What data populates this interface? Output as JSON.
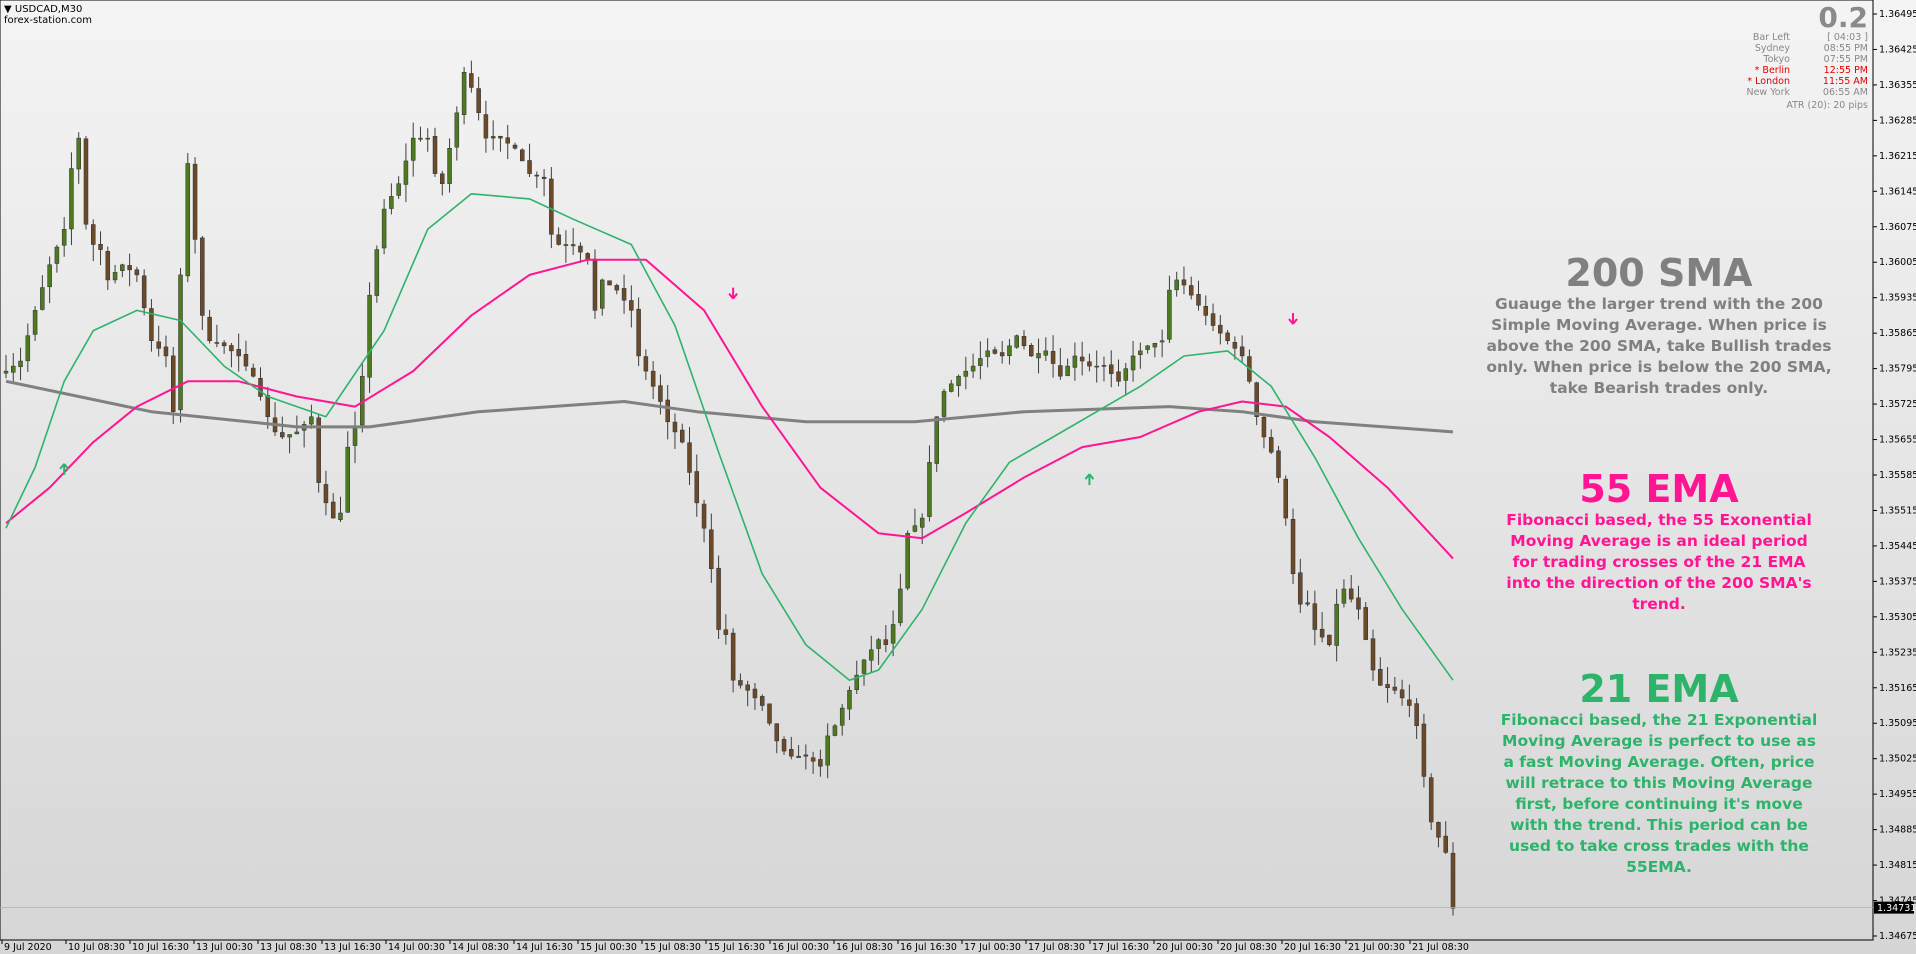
{
  "header": {
    "symbol": "USDCAD,M30",
    "source": "forex-station.com"
  },
  "panel": {
    "big_value": "0.2",
    "rows": [
      {
        "label": "Bar Left",
        "value": "[ 04:03 ]",
        "highlight": false
      },
      {
        "label": "Sydney",
        "value": "08:55 PM",
        "highlight": false
      },
      {
        "label": "Tokyo",
        "value": "07:55 PM",
        "highlight": false
      },
      {
        "label": "* Berlin",
        "value": "12:55 PM",
        "highlight": true
      },
      {
        "label": "* London",
        "value": "11:55 AM",
        "highlight": true
      },
      {
        "label": "New York",
        "value": "06:55 AM",
        "highlight": false
      }
    ],
    "atr": "ATR (20): 20 pips"
  },
  "notes": {
    "sma200": {
      "title": "200 SMA",
      "body": "Guauge the larger trend with the 200 Simple Moving Average. When price is above the 200 SMA, take Bullish trades only. When price is below the 200 SMA, take Bearish trades only.",
      "color": "#808080"
    },
    "ema55": {
      "title": "55 EMA",
      "body": "Fibonacci based, the 55 Exonential Moving Average is an ideal period for trading crosses of the 21 EMA into the direction of the 200 SMA's trend.",
      "color": "#ff1493"
    },
    "ema21": {
      "title": "21 EMA",
      "body": "Fibonacci based, the 21 Exponential Moving Average is perfect to use as a fast Moving Average. Often, price will retrace to this Moving Average first, before continuing it's move with the trend. This period can be used to take cross trades with the 55EMA.",
      "color": "#2eb36b"
    }
  },
  "colors": {
    "sma200": "#808080",
    "ema55": "#ff1493",
    "ema21": "#2eb36b",
    "candle": "#4d7a1f",
    "candle_dark": "#6b4a2a"
  },
  "chart_data": {
    "type": "line",
    "y_ticks": [
      "1.34675",
      "1.34745",
      "1.34815",
      "1.34885",
      "1.34955",
      "1.35025",
      "1.35095",
      "1.35165",
      "1.35235",
      "1.35305",
      "1.35375",
      "1.35445",
      "1.35515",
      "1.35585",
      "1.35655",
      "1.35725",
      "1.35795",
      "1.35865",
      "1.35935",
      "1.36005",
      "1.36075",
      "1.36145",
      "1.36215",
      "1.36285",
      "1.36355",
      "1.36425",
      "1.36495"
    ],
    "ylim": [
      1.34675,
      1.36495
    ],
    "current_price": "1.34731",
    "x_ticks": [
      "9 Jul 2020",
      "10 Jul 08:30",
      "10 Jul 16:30",
      "13 Jul 00:30",
      "13 Jul 08:30",
      "13 Jul 16:30",
      "14 Jul 00:30",
      "14 Jul 08:30",
      "14 Jul 16:30",
      "15 Jul 00:30",
      "15 Jul 08:30",
      "15 Jul 16:30",
      "16 Jul 00:30",
      "16 Jul 08:30",
      "16 Jul 16:30",
      "17 Jul 00:30",
      "17 Jul 08:30",
      "17 Jul 16:30",
      "20 Jul 00:30",
      "20 Jul 08:30",
      "20 Jul 16:30",
      "21 Jul 00:30",
      "21 Jul 08:30"
    ],
    "price_path": [
      [
        0,
        1.3579
      ],
      [
        2,
        1.3581
      ],
      [
        4,
        1.3591
      ],
      [
        6,
        1.36
      ],
      [
        8,
        1.3607
      ],
      [
        9,
        1.3619
      ],
      [
        10,
        1.3625
      ],
      [
        11,
        1.3608
      ],
      [
        12,
        1.3604
      ],
      [
        13,
        1.3603
      ],
      [
        14,
        1.3597
      ],
      [
        16,
        1.36
      ],
      [
        18,
        1.3598
      ],
      [
        20,
        1.3585
      ],
      [
        22,
        1.3582
      ],
      [
        23,
        1.3571
      ],
      [
        24,
        1.3598
      ],
      [
        25,
        1.362
      ],
      [
        26,
        1.3605
      ],
      [
        27,
        1.359
      ],
      [
        28,
        1.3585
      ],
      [
        30,
        1.3584
      ],
      [
        32,
        1.3582
      ],
      [
        34,
        1.3578
      ],
      [
        35,
        1.3574
      ],
      [
        36,
        1.357
      ],
      [
        37,
        1.3567
      ],
      [
        38,
        1.3566
      ],
      [
        40,
        1.3567
      ],
      [
        42,
        1.357
      ],
      [
        43,
        1.3557
      ],
      [
        44,
        1.3553
      ],
      [
        45,
        1.355
      ],
      [
        46,
        1.3551
      ],
      [
        47,
        1.3564
      ],
      [
        48,
        1.3568
      ],
      [
        49,
        1.3578
      ],
      [
        50,
        1.3594
      ],
      [
        51,
        1.3603
      ],
      [
        52,
        1.3611
      ],
      [
        54,
        1.3616
      ],
      [
        56,
        1.3625
      ],
      [
        58,
        1.3625
      ],
      [
        59,
        1.3618
      ],
      [
        60,
        1.3616
      ],
      [
        62,
        1.363
      ],
      [
        63,
        1.3638
      ],
      [
        64,
        1.3635
      ],
      [
        66,
        1.3625
      ],
      [
        68,
        1.3625
      ],
      [
        70,
        1.3623
      ],
      [
        72,
        1.3618
      ],
      [
        74,
        1.3617
      ],
      [
        75,
        1.3606
      ],
      [
        76,
        1.3604
      ],
      [
        78,
        1.3604
      ],
      [
        80,
        1.3601
      ],
      [
        81,
        1.3591
      ],
      [
        82,
        1.3597
      ],
      [
        84,
        1.3595
      ],
      [
        86,
        1.3591
      ],
      [
        87,
        1.3582
      ],
      [
        89,
        1.3576
      ],
      [
        90,
        1.3573
      ],
      [
        91,
        1.3569
      ],
      [
        93,
        1.3565
      ],
      [
        94,
        1.3559
      ],
      [
        95,
        1.3553
      ],
      [
        96,
        1.3548
      ],
      [
        97,
        1.354
      ],
      [
        98,
        1.3528
      ],
      [
        99,
        1.3527
      ],
      [
        100,
        1.3518
      ],
      [
        102,
        1.3516
      ],
      [
        104,
        1.3513
      ],
      [
        106,
        1.3506
      ],
      [
        107,
        1.3504
      ],
      [
        108,
        1.3503
      ],
      [
        110,
        1.3503
      ],
      [
        112,
        1.3501
      ],
      [
        113,
        1.3507
      ],
      [
        114,
        1.3509
      ],
      [
        116,
        1.3516
      ],
      [
        118,
        1.3522
      ],
      [
        120,
        1.3526
      ],
      [
        121,
        1.3525
      ],
      [
        122,
        1.3529
      ],
      [
        123,
        1.3536
      ],
      [
        124,
        1.3547
      ],
      [
        126,
        1.355
      ],
      [
        127,
        1.3561
      ],
      [
        128,
        1.357
      ],
      [
        129,
        1.3575
      ],
      [
        131,
        1.3578
      ],
      [
        133,
        1.358
      ],
      [
        135,
        1.3583
      ],
      [
        137,
        1.3582
      ],
      [
        139,
        1.3586
      ],
      [
        141,
        1.3582
      ],
      [
        143,
        1.3583
      ],
      [
        145,
        1.3578
      ],
      [
        147,
        1.3582
      ],
      [
        149,
        1.358
      ],
      [
        151,
        1.358
      ],
      [
        153,
        1.3577
      ],
      [
        155,
        1.3582
      ],
      [
        157,
        1.3584
      ],
      [
        159,
        1.3585
      ],
      [
        160,
        1.3595
      ],
      [
        161,
        1.3597
      ],
      [
        162,
        1.3596
      ],
      [
        164,
        1.3592
      ],
      [
        166,
        1.3588
      ],
      [
        168,
        1.3585
      ],
      [
        170,
        1.3582
      ],
      [
        171,
        1.3577
      ],
      [
        172,
        1.357
      ],
      [
        173,
        1.3566
      ],
      [
        174,
        1.3563
      ],
      [
        175,
        1.3558
      ],
      [
        176,
        1.355
      ],
      [
        177,
        1.3539
      ],
      [
        178,
        1.3533
      ],
      [
        179,
        1.3533
      ],
      [
        180,
        1.3528
      ],
      [
        182,
        1.3525
      ],
      [
        183,
        1.3533
      ],
      [
        184,
        1.3536
      ],
      [
        186,
        1.3532
      ],
      [
        187,
        1.3526
      ],
      [
        188,
        1.352
      ],
      [
        189,
        1.3517
      ],
      [
        191,
        1.3516
      ],
      [
        193,
        1.3513
      ],
      [
        194,
        1.3509
      ],
      [
        195,
        1.3499
      ],
      [
        196,
        1.349
      ],
      [
        197,
        1.3487
      ],
      [
        198,
        1.3484
      ],
      [
        199,
        1.3473
      ]
    ],
    "series": [
      {
        "name": "200 SMA",
        "values": [
          [
            0,
            1.3577
          ],
          [
            20,
            1.3571
          ],
          [
            40,
            1.3568
          ],
          [
            50,
            1.3568
          ],
          [
            65,
            1.3571
          ],
          [
            85,
            1.3573
          ],
          [
            95,
            1.3571
          ],
          [
            110,
            1.3569
          ],
          [
            125,
            1.3569
          ],
          [
            140,
            1.3571
          ],
          [
            160,
            1.3572
          ],
          [
            170,
            1.3571
          ],
          [
            180,
            1.3569
          ],
          [
            199,
            1.3567
          ]
        ]
      },
      {
        "name": "55 EMA",
        "values": [
          [
            0,
            1.3549
          ],
          [
            6,
            1.3556
          ],
          [
            12,
            1.3565
          ],
          [
            18,
            1.3572
          ],
          [
            25,
            1.3577
          ],
          [
            32,
            1.3577
          ],
          [
            40,
            1.3574
          ],
          [
            48,
            1.3572
          ],
          [
            56,
            1.3579
          ],
          [
            64,
            1.359
          ],
          [
            72,
            1.3598
          ],
          [
            80,
            1.3601
          ],
          [
            88,
            1.3601
          ],
          [
            96,
            1.3591
          ],
          [
            104,
            1.3572
          ],
          [
            112,
            1.3556
          ],
          [
            120,
            1.3547
          ],
          [
            126,
            1.3546
          ],
          [
            132,
            1.3551
          ],
          [
            140,
            1.3558
          ],
          [
            148,
            1.3564
          ],
          [
            156,
            1.3566
          ],
          [
            164,
            1.3571
          ],
          [
            170,
            1.3573
          ],
          [
            176,
            1.3572
          ],
          [
            182,
            1.3566
          ],
          [
            190,
            1.3556
          ],
          [
            199,
            1.3542
          ]
        ]
      },
      {
        "name": "21 EMA",
        "values": [
          [
            0,
            1.3548
          ],
          [
            4,
            1.356
          ],
          [
            8,
            1.3577
          ],
          [
            12,
            1.3587
          ],
          [
            18,
            1.3591
          ],
          [
            24,
            1.3589
          ],
          [
            30,
            1.358
          ],
          [
            36,
            1.3574
          ],
          [
            44,
            1.357
          ],
          [
            52,
            1.3587
          ],
          [
            58,
            1.3607
          ],
          [
            64,
            1.3614
          ],
          [
            72,
            1.3613
          ],
          [
            78,
            1.3609
          ],
          [
            86,
            1.3604
          ],
          [
            92,
            1.3588
          ],
          [
            98,
            1.3563
          ],
          [
            104,
            1.3539
          ],
          [
            110,
            1.3525
          ],
          [
            116,
            1.3518
          ],
          [
            120,
            1.352
          ],
          [
            126,
            1.3532
          ],
          [
            132,
            1.3549
          ],
          [
            138,
            1.3561
          ],
          [
            144,
            1.3566
          ],
          [
            150,
            1.3571
          ],
          [
            156,
            1.3576
          ],
          [
            162,
            1.3582
          ],
          [
            168,
            1.3583
          ],
          [
            174,
            1.3576
          ],
          [
            180,
            1.3562
          ],
          [
            186,
            1.3546
          ],
          [
            192,
            1.3532
          ],
          [
            199,
            1.3518
          ]
        ]
      }
    ],
    "arrows": [
      {
        "index": 8,
        "price": 1.35595,
        "dir": "up",
        "color": "#2eb36b"
      },
      {
        "index": 100,
        "price": 1.35945,
        "dir": "down",
        "color": "#ff1493"
      },
      {
        "index": 149,
        "price": 1.35575,
        "dir": "up",
        "color": "#2eb36b"
      },
      {
        "index": 177,
        "price": 1.35895,
        "dir": "down",
        "color": "#ff1493"
      }
    ]
  }
}
